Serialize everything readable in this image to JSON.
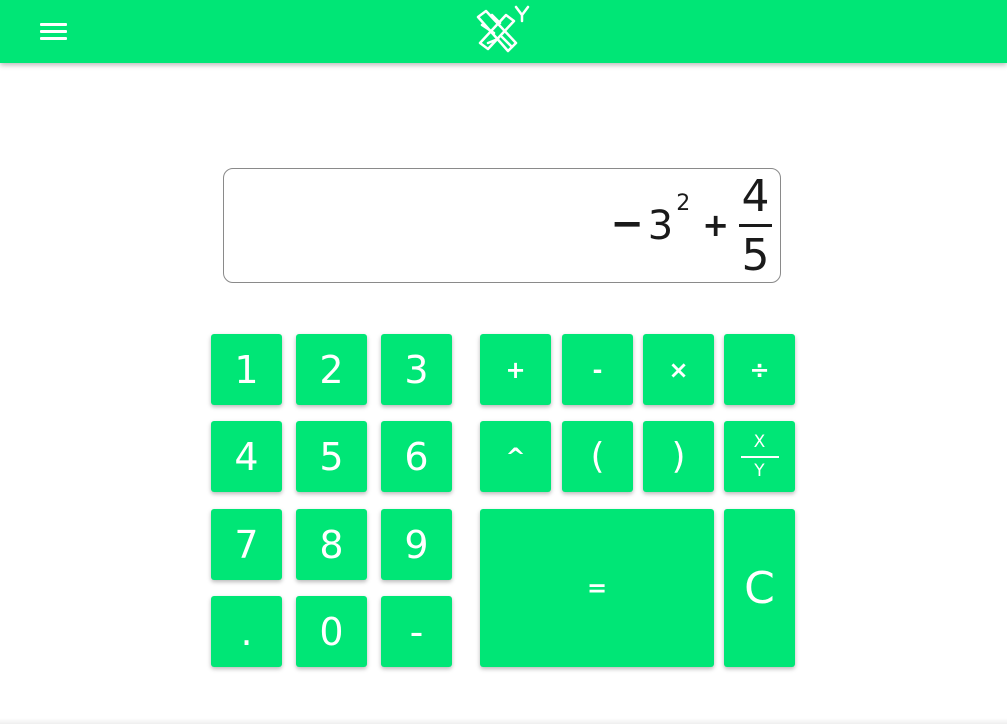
{
  "brand_color": "#00e676",
  "header": {
    "menu_icon": "hamburger-menu-icon",
    "logo_icon": "x-logo-icon"
  },
  "display": {
    "negative_sign": "−",
    "base": "3",
    "exponent": "2",
    "operator": "+",
    "numerator": "4",
    "denominator": "5"
  },
  "keypad": {
    "digits": {
      "one": "1",
      "two": "2",
      "three": "3",
      "four": "4",
      "five": "5",
      "six": "6",
      "seven": "7",
      "eight": "8",
      "nine": "9",
      "decimal": ".",
      "zero": "0",
      "negative": "-"
    },
    "operators": {
      "plus": "+",
      "minus": "-",
      "times": "×",
      "divide": "÷",
      "power": "^",
      "open_paren": "(",
      "close_paren": ")",
      "fraction_top": "X",
      "fraction_bottom": "Y",
      "equals": "=",
      "clear": "C"
    }
  }
}
